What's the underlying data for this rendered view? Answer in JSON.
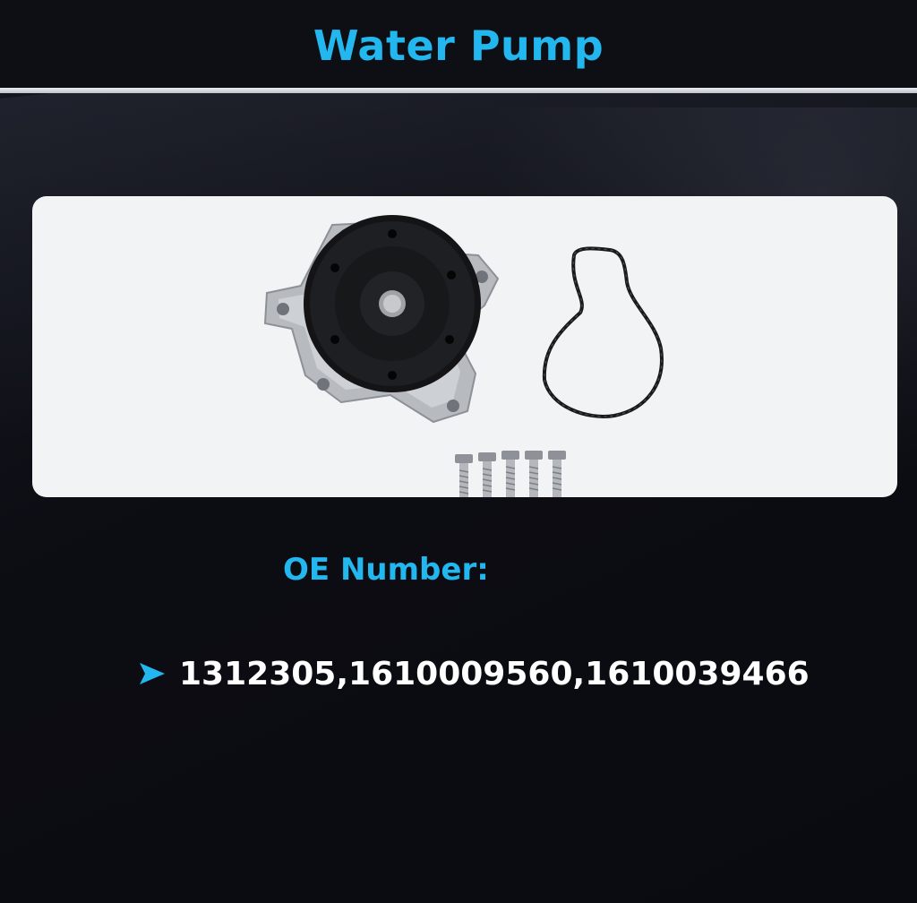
{
  "header": {
    "title": "Water Pump"
  },
  "product_image": {
    "parts": [
      "water-pump-icon",
      "gasket-icon",
      "bolt-icon"
    ]
  },
  "oe": {
    "label": "OE Number:",
    "values": "1312305,1610009560,1610039466",
    "bullet_icon": "triangle-arrow-icon"
  },
  "colors": {
    "accent": "#22b7ef",
    "background": "#0c0d12",
    "panel": "#f2f3f5",
    "text": "#ffffff"
  }
}
